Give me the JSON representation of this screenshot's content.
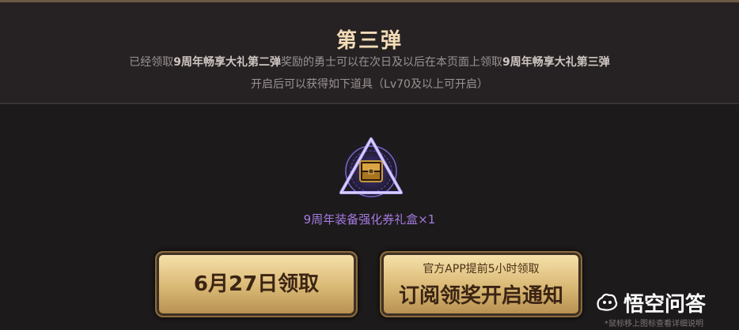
{
  "header": {
    "title": "第三弹",
    "line1_parts": [
      {
        "text": "已经领取",
        "bold": false
      },
      {
        "text": "9周年畅享大礼第二弹",
        "bold": true
      },
      {
        "text": "奖励的勇士可以在次日及以后在本页面上领取",
        "bold": false
      },
      {
        "text": "9周年畅享大礼第三弹",
        "bold": true
      }
    ],
    "line2": "开启后可以获得如下道具（Lv70及以上可开启）"
  },
  "reward": {
    "icon": "treasure-box-icon",
    "name": "9周年装备强化券礼盒×1"
  },
  "buttons": {
    "claim_label": "6月27日领取",
    "subscribe_small": "官方APP提前5小时领取",
    "subscribe_label": "订阅领奖开启通知"
  },
  "watermark": {
    "icon": "wukong-logo-icon",
    "text": "悟空问答"
  },
  "hint": "*鼠标移上图标查看详细说明",
  "colors": {
    "background": "#1d1a1b",
    "title": "#f2dcb6",
    "reward_name": "#a47be0",
    "button_gold": "#d9b874"
  }
}
